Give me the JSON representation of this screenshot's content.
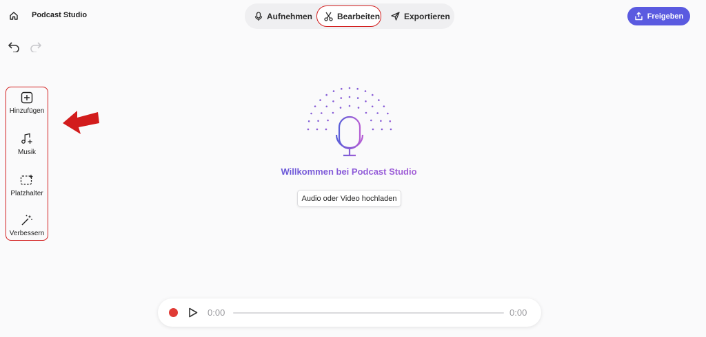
{
  "header": {
    "app_title": "Podcast Studio",
    "modes": [
      {
        "label": "Aufnehmen",
        "icon": "microphone-icon",
        "active": false
      },
      {
        "label": "Bearbeiten",
        "icon": "scissors-icon",
        "active": true
      },
      {
        "label": "Exportieren",
        "icon": "send-icon",
        "active": false
      }
    ],
    "share_label": "Freigeben"
  },
  "toolbar": {
    "items": [
      {
        "label": "Hinzufügen",
        "icon": "add-box-icon"
      },
      {
        "label": "Musik",
        "icon": "music-add-icon"
      },
      {
        "label": "Platzhalter",
        "icon": "placeholder-icon"
      },
      {
        "label": "Verbessern",
        "icon": "magic-wand-icon"
      }
    ]
  },
  "main": {
    "welcome": "Willkommen bei Podcast Studio",
    "upload_label": "Audio oder Video hochladen"
  },
  "player": {
    "current_time": "0:00",
    "total_time": "0:00",
    "progress": 0
  },
  "colors": {
    "accent": "#5a5ae0",
    "highlight_border": "#d21c1c",
    "record": "#e03b36",
    "arrow": "#d21c1c"
  }
}
